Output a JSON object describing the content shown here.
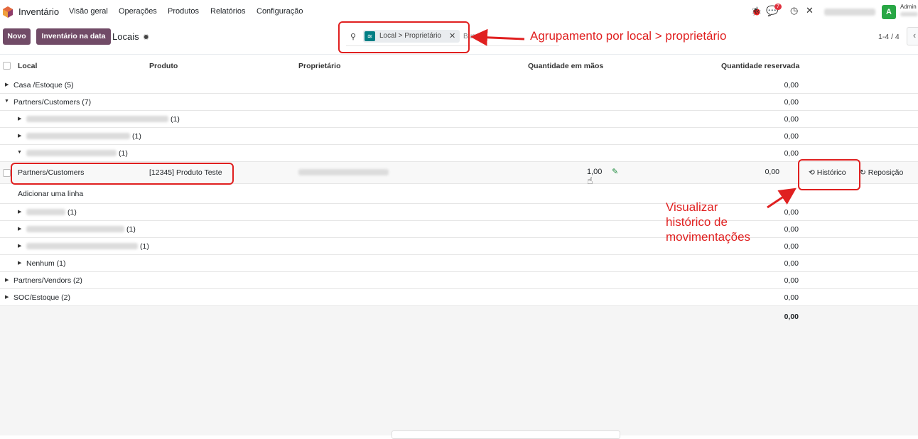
{
  "navbar": {
    "app_name": "Inventário",
    "menus": [
      "Visão geral",
      "Operações",
      "Produtos",
      "Relatórios",
      "Configuração"
    ],
    "messages_count": "7",
    "avatar_letter": "A",
    "user_name": "Admin"
  },
  "control_panel": {
    "new_button": "Novo",
    "inventory_at_date_button": "Inventário na data",
    "breadcrumb": "Locais",
    "search_facet": "Local > Proprietário",
    "search_placeholder": "Bus",
    "pager": "1-4 / 4"
  },
  "columns": {
    "local": "Local",
    "produto": "Produto",
    "proprietario": "Proprietário",
    "quantidade_em_maos": "Quantidade em mãos",
    "quantidade_reservada": "Quantidade reservada"
  },
  "groups": [
    {
      "label": "Casa /Estoque (5)",
      "reserved": "0,00"
    },
    {
      "label": "Partners/Customers (7)",
      "reserved": "0,00"
    }
  ],
  "subgroups_top": [
    {
      "count": "(1)",
      "reserved": "0,00"
    },
    {
      "count": "(1)",
      "reserved": "0,00"
    },
    {
      "count": "(1)",
      "reserved": "0,00"
    }
  ],
  "record": {
    "local": "Partners/Customers",
    "produto": "[12345] Produto Teste",
    "quantidade": "1,00",
    "reservada": "0,00",
    "historico_button": "Histórico",
    "reposicao_button": "Reposição"
  },
  "add_line": "Adicionar uma linha",
  "subgroups_bottom": [
    {
      "count": "(1)",
      "reserved": "0,00"
    },
    {
      "count": "(1)",
      "reserved": "0,00"
    },
    {
      "count": "(1)",
      "reserved": "0,00"
    },
    {
      "label": "Nenhum (1)",
      "reserved": "0,00"
    }
  ],
  "groups_bottom": [
    {
      "label": "Partners/Vendors (2)",
      "reserved": "0,00"
    },
    {
      "label": "SOC/Estoque (2)",
      "reserved": "0,00"
    }
  ],
  "total_reserved": "0,00",
  "annotations": {
    "grouping": "Agrupamento por local > proprietário",
    "history": [
      "Visualizar",
      "histórico de",
      "movimentações"
    ]
  },
  "colors": {
    "brand": "#714b67",
    "teal": "#017e84",
    "annotation_red": "#e02020"
  }
}
